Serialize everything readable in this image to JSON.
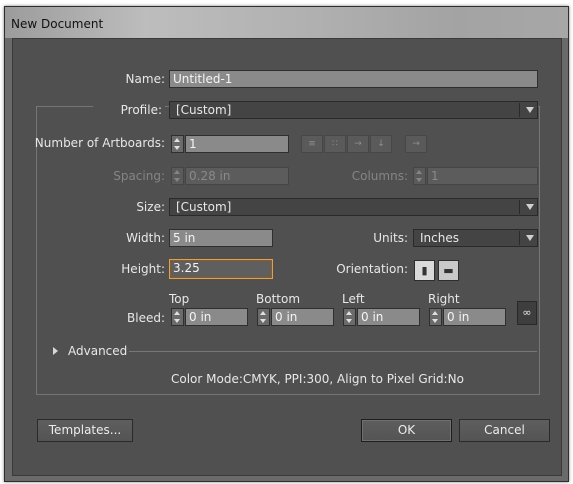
{
  "window": {
    "title": "New Document"
  },
  "name": {
    "label": "Name:",
    "value": "Untitled-1"
  },
  "profile": {
    "label": "Profile:",
    "value": "[Custom]"
  },
  "artboards": {
    "number_label": "Number of Artboards:",
    "number_value": "1",
    "spacing_label": "Spacing:",
    "spacing_value": "0.28 in",
    "columns_label": "Columns:",
    "columns_value": "1"
  },
  "size": {
    "label": "Size:",
    "value": "[Custom]"
  },
  "width": {
    "label": "Width:",
    "value": "5 in"
  },
  "units": {
    "label": "Units:",
    "value": "Inches"
  },
  "height": {
    "label": "Height:",
    "value": "3.25"
  },
  "orientation": {
    "label": "Orientation:"
  },
  "bleed": {
    "label": "Bleed:",
    "top_label": "Top",
    "top_value": "0 in",
    "bottom_label": "Bottom",
    "bottom_value": "0 in",
    "left_label": "Left",
    "left_value": "0 in",
    "right_label": "Right",
    "right_value": "0 in"
  },
  "advanced": {
    "label": "Advanced"
  },
  "info": {
    "text": "Color Mode:CMYK, PPI:300, Align to Pixel Grid:No"
  },
  "buttons": {
    "templates": "Templates...",
    "ok": "OK",
    "cancel": "Cancel"
  },
  "icons": {
    "arrange": [
      "grid-by-row-icon",
      "grid-by-column-icon",
      "arrange-by-row-icon",
      "arrange-by-column-icon",
      "right-to-left-icon"
    ],
    "orientation": [
      "portrait-icon",
      "landscape-icon"
    ],
    "link": "chain-link-icon"
  }
}
